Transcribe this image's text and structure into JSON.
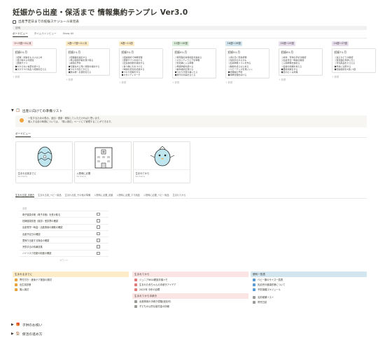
{
  "page": {
    "title": "妊娠から出産・保活まで 情報集約テンプレ Ver3.0",
    "schedule_section_title": "出産予定日までの妊娠スケジュール早見表",
    "schedule_bar_text": "説明",
    "schedule_tabs": [
      "ボードビュー",
      "タイムラインビュー",
      "Show All"
    ],
    "new_label": "+ 新規"
  },
  "schedule": [
    {
      "chip": "0〜3週〜0ヶ月",
      "chip_bg": "#fbe4e4",
      "card_title": "妊娠0ヶ月",
      "items": [
        "□妊娠・診察をもらいはじめ",
        "□受け取れる可能性",
        "□葉酸サプリ",
        "■わからない言葉を調べる",
        "■かかりつけ先生へ妊娠を伝える"
      ]
    },
    {
      "chip": "4週〜7週〜2ヶ月",
      "chip_bg": "#fdecc8",
      "card_title": "妊娠2ヶ月",
      "items": [
        "□妊娠届を提出する",
        "□母子健康手帳を受け取る",
        "□産院の予約",
        "■仕事先や上司に報告を検討する",
        "■つわりが出てきたら",
        "■飲み物・お酒を控える"
      ]
    },
    {
      "chip": "8週〜11週",
      "chip_bg": "#fdecc8",
      "card_title": "妊娠3ヶ月",
      "items": [
        "□妊婦健診で体重管理",
        "□葉酸サプリを続ける",
        "□出生前診断を検討する",
        "□食べ物に気をつける",
        "□体調の変化を記録する",
        "■つわり対策をする",
        "■マタニティマーク"
      ]
    },
    {
      "chip": "12週〜15週",
      "chip_bg": "#dbeddb",
      "card_title": "妊娠4ヶ月",
      "items": [
        "□保育園の情報収集を始める",
        "□マタニティウェアを準備",
        "□安定期に入る準備",
        "□母親学級を調べる",
        "□歯科検診を受ける",
        "■つわりが落ち着いたら",
        "■旅行の計画を立てる"
      ]
    },
    {
      "chip": "16週〜19週",
      "chip_bg": "#d3e5ef",
      "card_title": "妊娠5ヶ月",
      "items": [
        "□戌の日に安産祈願",
        "□性別がわかるかも",
        "□出産準備リストを作る",
        "□胎動を感じはじめる",
        "□ベビーグッズを見にいく",
        "■妊娠線の予防",
        "■体重管理を続ける"
      ]
    },
    {
      "chip": "20週〜23週",
      "chip_bg": "#e8deee",
      "card_title": "妊娠6ヶ月",
      "items": [
        "□産休・育休の手続き確認",
        "□出産育児一時金の確認",
        "□入院準備を始める",
        "□名前の候補を考える",
        "■腰痛対策をする",
        "■足のむくみ対策"
      ]
    },
    {
      "chip": "24週〜27週",
      "chip_bg": "#e8deee",
      "card_title": "妊娠7ヶ月",
      "items": [
        "□逆子かどうか確認",
        "□保育園の見学に行く",
        "□育児用品をそろえる",
        "■早産に注意する",
        "■妊婦健診を2週に1回"
      ]
    }
  ],
  "prep": {
    "toggle_title": "出産に向けての準備リスト",
    "callout_line1": "一覧するための表示。追加・更新・削除していただければと思います。",
    "callout_line2": "購入する前の時期については、「購入検討」ページにて管理することができます。",
    "gallery_tab": "ボードビュー",
    "gallery": [
      {
        "label": "生まれる前までに",
        "sub": "No Items",
        "img": "egg"
      },
      {
        "label": "入院時に必要",
        "sub": "No Items",
        "img": "building"
      },
      {
        "label": "生まれてから",
        "sub": "No Items",
        "img": "bird"
      }
    ],
    "list_tabs": [
      "生まれる前_手続き",
      "生まれる前_ベビー用品",
      "生まれる前_その他の準備",
      "入院時に必要_書類",
      "入院時に必要_ママ用品",
      "入院時に必要_ベビー用品",
      "生まれてから"
    ],
    "list_header": "名前",
    "rows": [
      "母子健康手帳（母子手帳）を受け取る",
      "妊婦健康診査（健診）受診票の確認",
      "出産育児一時金・出産費用の補助の確認",
      "出産予定日の確認",
      "里帰り出産する場合の確認",
      "児童手当の情報収集",
      "ハイリスク妊娠の制度の確認"
    ],
    "row_more": "カウント"
  },
  "bottom": {
    "col1_head": "生まれるまでに",
    "col1_items": [
      "寄付付き・産後ケア施設の検討",
      "出生前診断",
      "購入検討"
    ],
    "col2_head": "生まれてから",
    "col2_items": [
      "ジュニアNISA開設手順メモ",
      "生まれた赤ちゃんの手続きアイデア",
      "2023年 今年の目標"
    ],
    "col2_sub_head": "生まれてから手続き",
    "col2_sub_items": [
      "出産費用の手続き書類(追加可)",
      "子どもの公的な給付金の情報"
    ],
    "col3_head": "便利一覧表",
    "col3_items": [
      "ベビー服のサイズ一覧表",
      "乳幼児の健康診断について",
      "予防接種スケジュール"
    ],
    "col3_sub_items": [
      "名前候補リスト",
      "育児日誌"
    ]
  },
  "footer": {
    "toggle1": "子供のお祝い",
    "toggle2": "保活の進め方"
  }
}
